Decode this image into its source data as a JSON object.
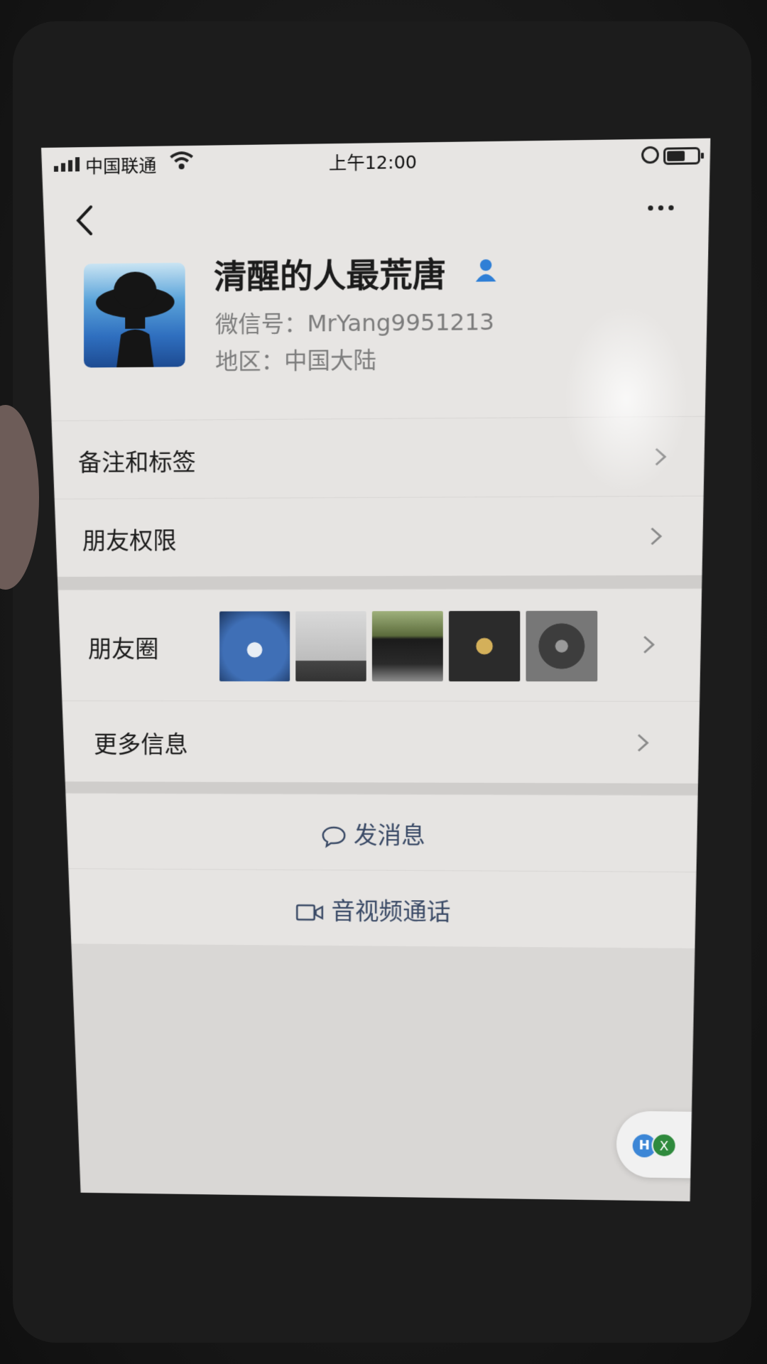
{
  "status_bar": {
    "carrier": "中国联通",
    "time": "上午12:00"
  },
  "profile": {
    "name": "清醒的人最荒唐",
    "wechat_id": "微信号：MrYang9951213",
    "region": "地区：中国大陆"
  },
  "menu": {
    "remarks_label": "备注和标签",
    "permissions_label": "朋友权限",
    "moments_label": "朋友圈",
    "more_info_label": "更多信息"
  },
  "actions": {
    "message_label": "发消息",
    "call_label": "音视频通话"
  },
  "floating": {
    "icon1_text": "H",
    "icon2_text": "X"
  },
  "colors": {
    "badge": "#2f7fd6",
    "action_text": "#3a4a66"
  },
  "icons": {
    "back": "chevron-left",
    "more": "ellipsis",
    "badge": "person",
    "message": "chat-bubble",
    "call": "video-camera"
  }
}
